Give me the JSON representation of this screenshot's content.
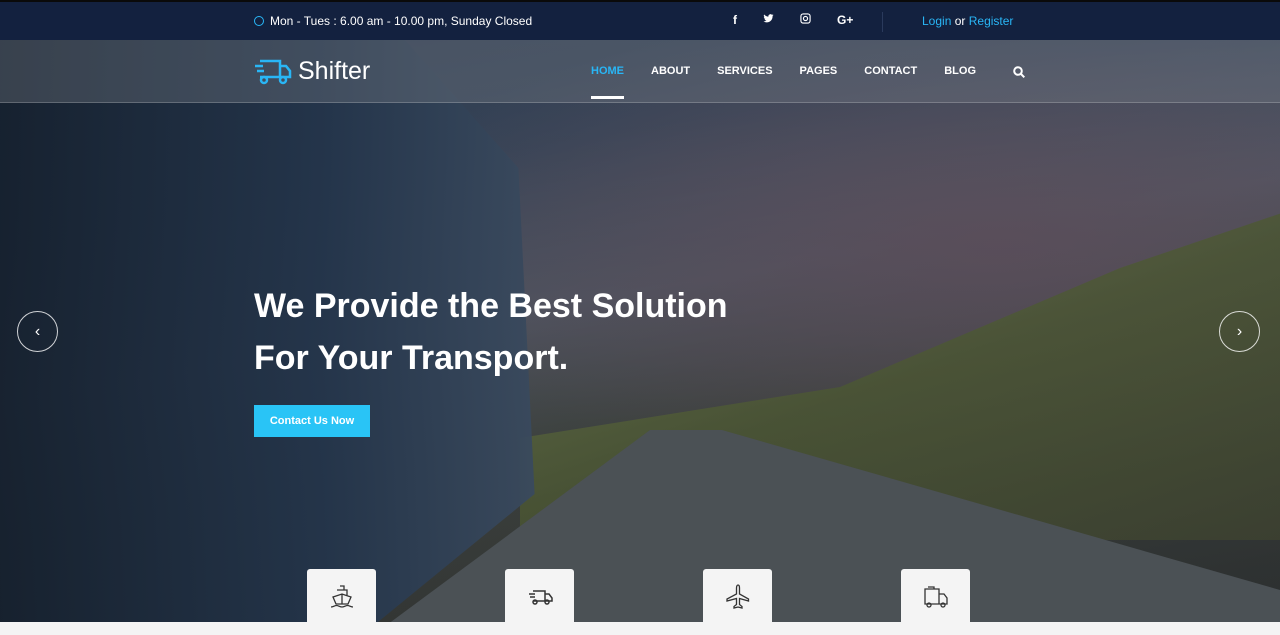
{
  "topbar": {
    "hours": "Mon - Tues : 6.00 am - 10.00 pm, Sunday Closed",
    "social": [
      "f",
      "t",
      "ig",
      "G+"
    ],
    "login": "Login",
    "or": "or",
    "register": "Register"
  },
  "nav": {
    "logo": "Shifter",
    "items": [
      "HOME",
      "ABOUT",
      "SERVICES",
      "PAGES",
      "CONTACT",
      "BLOG"
    ],
    "active": "HOME"
  },
  "hero": {
    "line1": "We Provide the Best Solution",
    "line2": "For Your Transport.",
    "cta": "Contact Us Now",
    "prev": "‹",
    "next": "›"
  },
  "services": [
    "ship-icon",
    "fast-truck-icon",
    "airplane-icon",
    "delivery-truck-icon"
  ],
  "colors": {
    "accent": "#29c4f6",
    "topbar": "#13213f"
  }
}
